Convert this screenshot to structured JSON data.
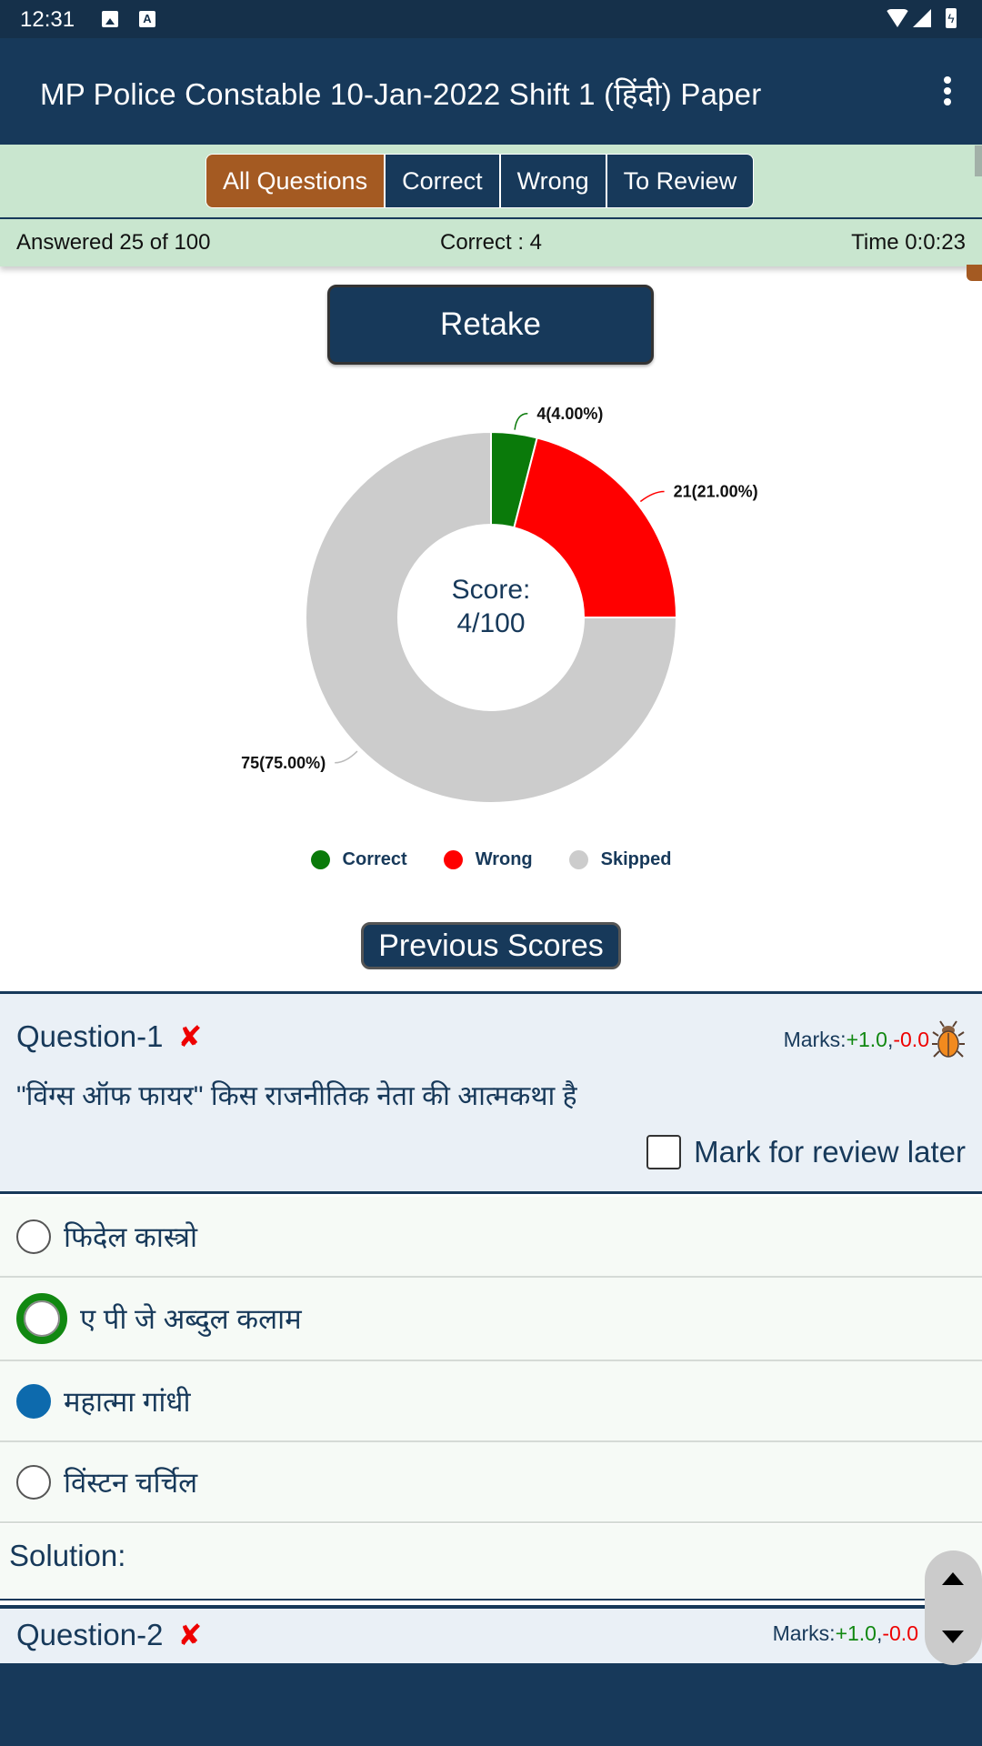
{
  "status_bar": {
    "time": "12:31",
    "icons": [
      "image-icon",
      "keyboard-a-icon",
      "wifi-icon",
      "signal-icon",
      "battery-charging-icon"
    ],
    "a_glyph": "A",
    "battery_glyph": "ϟ"
  },
  "app_bar": {
    "title": "MP Police Constable 10-Jan-2022 Shift 1 (हिंदी) Paper",
    "menu_icon": "more-vert-icon"
  },
  "filter_tabs": [
    {
      "label": "All Questions",
      "active": true
    },
    {
      "label": "Correct",
      "active": false
    },
    {
      "label": "Wrong",
      "active": false
    },
    {
      "label": "To Review",
      "active": false
    }
  ],
  "summary": {
    "answered": "Answered 25 of 100",
    "correct": "Correct : 4",
    "time": "Time 0:0:23"
  },
  "retake_label": "Retake",
  "chart_data": {
    "type": "pie",
    "donut": true,
    "title": "",
    "center_text": [
      "Score:",
      "4/100"
    ],
    "categories": [
      "Correct",
      "Wrong",
      "Skipped"
    ],
    "values": [
      4,
      21,
      75
    ],
    "percentages": [
      4.0,
      21.0,
      75.0
    ],
    "data_labels": [
      "4(4.00%)",
      "21(21.00%)",
      "75(75.00%)"
    ],
    "colors": [
      "#0a7a0a",
      "#ff0000",
      "#cccccc"
    ],
    "legend": {
      "placement": "bottom",
      "entries": [
        "Correct",
        "Wrong",
        "Skipped"
      ]
    }
  },
  "previous_scores_label": "Previous Scores",
  "questions": [
    {
      "title": "Question-1",
      "status_icon": "✘",
      "marks_label": "Marks:",
      "marks_positive": "+1.0",
      "marks_separator": ",",
      "marks_negative": "-0.0",
      "text": "\"विंग्स ऑफ फायर\" किस राजनीतिक नेता की आत्मकथा है",
      "review_label": "Mark for review later",
      "review_checked": false,
      "options": [
        {
          "text": "फिदेल कास्त्रो",
          "state": "none"
        },
        {
          "text": "ए पी जे अब्दुल कलाम",
          "state": "correct"
        },
        {
          "text": "महात्मा गांधी",
          "state": "selected"
        },
        {
          "text": "विंस्टन चर्चिल",
          "state": "none"
        }
      ],
      "solution_label": "Solution:"
    },
    {
      "title": "Question-2",
      "status_icon": "✘",
      "marks_label": "Marks:",
      "marks_positive": "+1.0",
      "marks_separator": ",",
      "marks_negative": "-0.0"
    }
  ],
  "colors": {
    "primary": "#17395a",
    "accent_tab": "#a45a22",
    "filter_bg": "#c9e6cf",
    "correct": "#0a7a0a",
    "wrong": "#ff0000",
    "skipped": "#cccccc",
    "selected_option": "#0d6aad"
  }
}
